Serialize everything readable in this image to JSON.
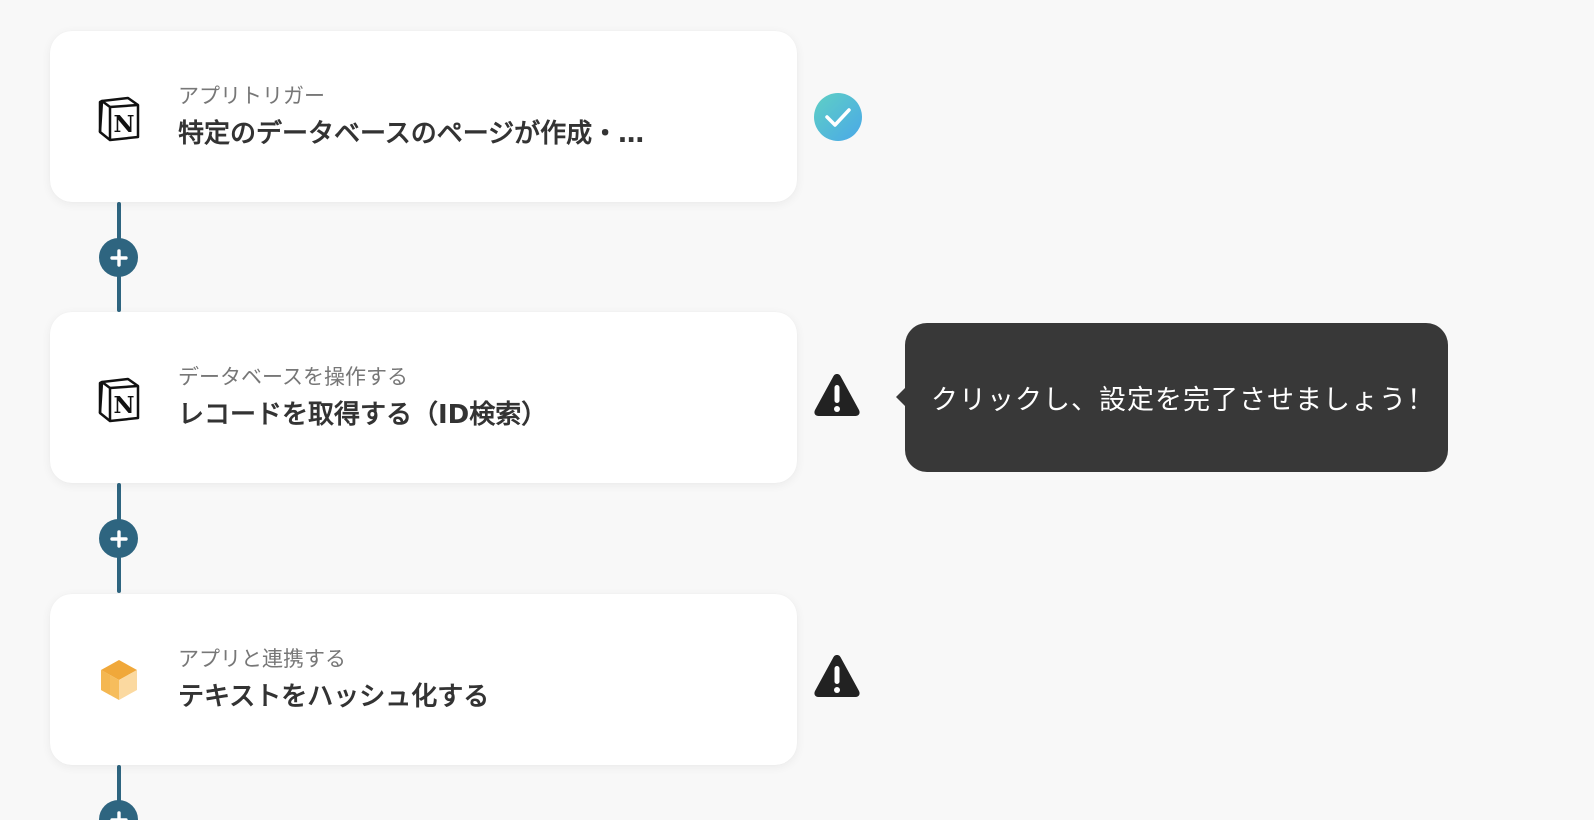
{
  "flow": {
    "steps": [
      {
        "app_icon": "notion-icon",
        "subtitle": "アプリトリガー",
        "title": "特定のデータベースのページが作成・…",
        "status": "check-circle-icon"
      },
      {
        "app_icon": "notion-icon",
        "subtitle": "データベースを操作する",
        "title": "レコードを取得する（ID検索）",
        "status": "warning-icon"
      },
      {
        "app_icon": "cube-icon",
        "subtitle": "アプリと連携する",
        "title": "テキストをハッシュ化する",
        "status": "warning-icon"
      }
    ],
    "add_step_icon": "plus-icon"
  },
  "tooltip": {
    "text": "クリックし、設定を完了させましょう！"
  },
  "colors": {
    "connector": "#2e6580",
    "check_gradient_start": "#5fd0c4",
    "check_gradient_end": "#4aa8e8",
    "warning": "#222222",
    "tooltip_bg": "#383838",
    "cube_dark": "#f0a83a",
    "cube_light": "#fbd9a0"
  }
}
